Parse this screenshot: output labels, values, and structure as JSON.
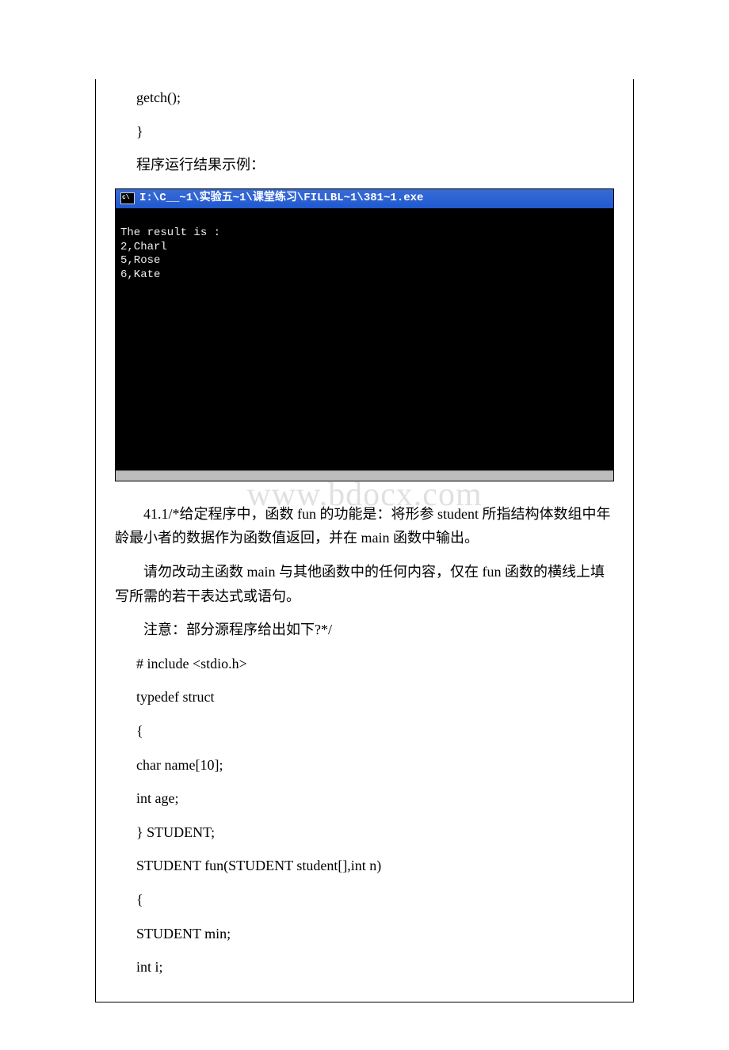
{
  "watermark": "www.bdocx.com",
  "cell1": {
    "line1": "getch();",
    "line2": "}",
    "result_label": "程序运行结果示例：",
    "console": {
      "title": "I:\\C__~1\\实验五~1\\课堂练习\\FILLBL~1\\381~1.exe",
      "body": "\nThe result is :\n2,Charl\n5,Rose\n6,Kate"
    }
  },
  "mid": {
    "p1": "41.1/*给定程序中，函数 fun 的功能是：将形参 student 所指结构体数组中年龄最小者的数据作为函数值返回，并在 main 函数中输出。",
    "p2": "请勿改动主函数 main 与其他函数中的任何内容，仅在 fun 函数的横线上填写所需的若干表达式或语句。",
    "p3": "注意：部分源程序给出如下?*/"
  },
  "code": {
    "l1": "# include <stdio.h>",
    "l2": "typedef struct",
    "l3": "{",
    "l4": " char name[10];",
    "l5": " int age;",
    "l6": "} STUDENT;",
    "l7": "STUDENT fun(STUDENT student[],int n)",
    "l8": "{",
    "l9": " STUDENT min;",
    "l10": " int i;"
  }
}
